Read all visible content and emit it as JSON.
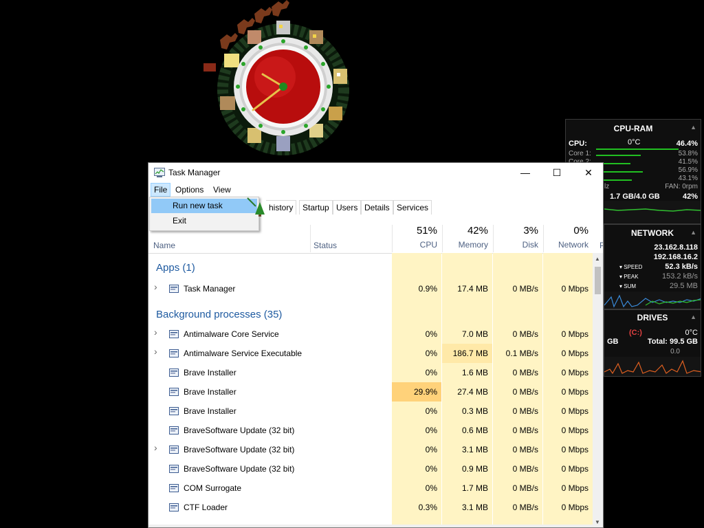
{
  "window": {
    "title": "Task Manager",
    "controls": {
      "minimize": "—",
      "maximize": "☐",
      "close": "✕"
    }
  },
  "menu": {
    "file": "File",
    "options": "Options",
    "view": "View"
  },
  "file_menu": {
    "items": [
      "Run new task",
      "Exit"
    ]
  },
  "tabs": [
    "history",
    "Startup",
    "Users",
    "Details",
    "Services"
  ],
  "columns": {
    "name": "Name",
    "status": "Status",
    "cpu": {
      "pct": "51%",
      "label": "CPU"
    },
    "memory": {
      "pct": "42%",
      "label": "Memory"
    },
    "disk": {
      "pct": "3%",
      "label": "Disk"
    },
    "network": {
      "pct": "0%",
      "label": "Network"
    },
    "power_truncated": "P"
  },
  "groups": {
    "apps": "Apps (1)",
    "background": "Background processes (35)"
  },
  "apps_rows": [
    {
      "name": "Task Manager",
      "cpu": "0.9%",
      "memory": "17.4 MB",
      "disk": "0 MB/s",
      "network": "0 Mbps",
      "expandable": true
    }
  ],
  "background_rows": [
    {
      "name": "Antimalware Core Service",
      "cpu": "0%",
      "memory": "7.0 MB",
      "disk": "0 MB/s",
      "network": "0 Mbps",
      "expandable": true
    },
    {
      "name": "Antimalware Service Executable",
      "cpu": "0%",
      "memory": "186.7 MB",
      "disk": "0.1 MB/s",
      "network": "0 Mbps",
      "expandable": true
    },
    {
      "name": "Brave Installer",
      "cpu": "0%",
      "memory": "1.6 MB",
      "disk": "0 MB/s",
      "network": "0 Mbps",
      "expandable": false
    },
    {
      "name": "Brave Installer",
      "cpu": "29.9%",
      "memory": "27.4 MB",
      "disk": "0 MB/s",
      "network": "0 Mbps",
      "expandable": false
    },
    {
      "name": "Brave Installer",
      "cpu": "0%",
      "memory": "0.3 MB",
      "disk": "0 MB/s",
      "network": "0 Mbps",
      "expandable": false
    },
    {
      "name": "BraveSoftware Update (32 bit)",
      "cpu": "0%",
      "memory": "0.6 MB",
      "disk": "0 MB/s",
      "network": "0 Mbps",
      "expandable": false
    },
    {
      "name": "BraveSoftware Update (32 bit)",
      "cpu": "0%",
      "memory": "3.1 MB",
      "disk": "0 MB/s",
      "network": "0 Mbps",
      "expandable": true
    },
    {
      "name": "BraveSoftware Update (32 bit)",
      "cpu": "0%",
      "memory": "0.9 MB",
      "disk": "0 MB/s",
      "network": "0 Mbps",
      "expandable": false
    },
    {
      "name": "COM Surrogate",
      "cpu": "0%",
      "memory": "1.7 MB",
      "disk": "0 MB/s",
      "network": "0 Mbps",
      "expandable": false
    },
    {
      "name": "CTF Loader",
      "cpu": "0.3%",
      "memory": "3.1 MB",
      "disk": "0 MB/s",
      "network": "0 Mbps",
      "expandable": false
    }
  ],
  "cpu_ram": {
    "title": "CPU-RAM",
    "cpu_label": "CPU:",
    "temp": "0°C",
    "cpu_value": "46.4%",
    "cores": [
      {
        "label": "Core 1:",
        "value": "53.8%",
        "level": 0.54
      },
      {
        "label": "Core 2:",
        "value": "41.5%",
        "level": 0.42
      },
      {
        "label": "",
        "value": "56.9%",
        "level": 0.57
      },
      {
        "label": "",
        "value": "43.1%",
        "level": 0.43
      }
    ],
    "freq_truncated": "lz",
    "fan": "FAN: 0rpm",
    "ram": "1.7 GB/4.0 GB",
    "ram_pct": "42%"
  },
  "network": {
    "title": "NETWORK",
    "ip1": "23.162.8.118",
    "ip2": "192.168.16.2",
    "speed_label": "SPEED",
    "speed": "52.3 kB/s",
    "peak_label": "PEAK",
    "peak": "153.2 kB/s",
    "sum_label": "SUM",
    "sum": "29.5 MB"
  },
  "drives": {
    "title": "DRIVES",
    "drive": "(C:)",
    "temp": "0°C",
    "gb_truncated": "GB",
    "total": "Total: 99.5 GB",
    "rate": "0.0"
  },
  "colors": {
    "accent": "#1e5aa0",
    "heat_light": "#fff4c4",
    "heat_mid": "#ffe9a8",
    "heat_high": "#ffd27a",
    "menu_highlight": "#91c9f7"
  }
}
